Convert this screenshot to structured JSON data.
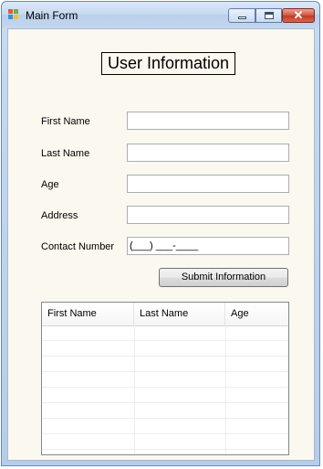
{
  "window": {
    "title": "Main Form",
    "icon": "windows-form-icon",
    "controls": [
      "minimize-icon",
      "maximize-icon",
      "close-icon"
    ],
    "close_glyph": "✕"
  },
  "form": {
    "heading": "User Information",
    "fields": {
      "first_name": {
        "label": "First Name",
        "value": ""
      },
      "last_name": {
        "label": "Last Name",
        "value": ""
      },
      "age": {
        "label": "Age",
        "value": ""
      },
      "address": {
        "label": "Address",
        "value": ""
      },
      "contact_number": {
        "label": "Contact Number",
        "mask": "(___) ___-____"
      }
    },
    "submit_label": "Submit Information"
  },
  "grid": {
    "columns": [
      "First Name",
      "Last Name",
      "Age"
    ],
    "rows": []
  },
  "colors": {
    "form_background": "#fbf8ef",
    "title_bar": "#c6d9ef",
    "close_button": "#c94630"
  }
}
